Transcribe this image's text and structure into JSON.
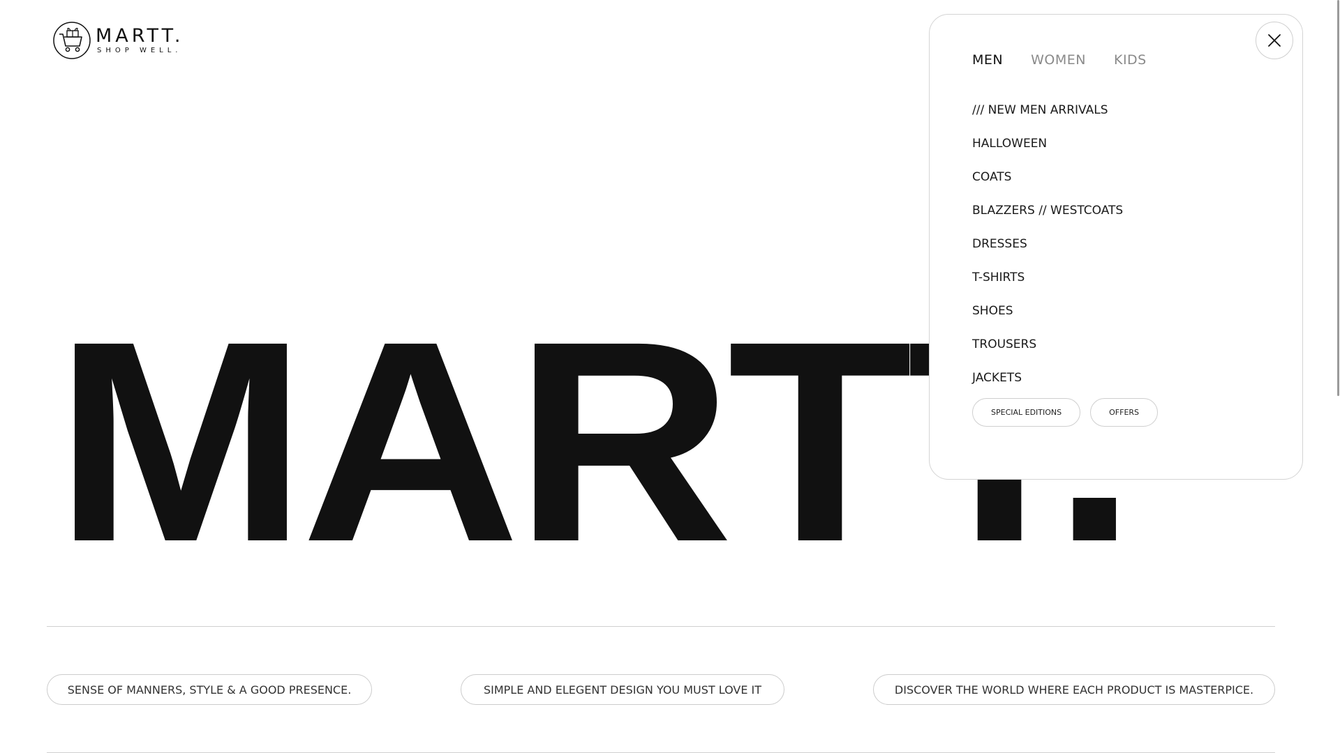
{
  "logo": {
    "name": "MARTT.",
    "tagline": "SHOP WELL."
  },
  "hero": {
    "text": "MARTT."
  },
  "pills": [
    "SENSE OF MANNERS, STYLE & A GOOD PRESENCE.",
    "SIMPLE AND ELEGENT DESIGN YOU MUST LOVE IT",
    "DISCOVER THE WORLD WHERE EACH PRODUCT IS MASTERPICE."
  ],
  "menu": {
    "tabs": [
      {
        "label": "MEN",
        "active": true
      },
      {
        "label": "WOMEN",
        "active": false
      },
      {
        "label": "KIDS",
        "active": false
      }
    ],
    "items": [
      "/// NEW MEN ARRIVALS",
      "HALLOWEEN",
      "COATS",
      "BLAZZERS // WESTCOATS",
      "DRESSES",
      "T-SHIRTS",
      "SHOES",
      "TROUSERS",
      "JACKETS"
    ],
    "chips": [
      "SPECIAL EDITIONS",
      "OFFERS"
    ],
    "close_icon": "close-icon"
  },
  "colors": {
    "text": "#111111",
    "muted": "#8a8a8a",
    "border": "#cfcfcf",
    "background": "#ffffff"
  }
}
